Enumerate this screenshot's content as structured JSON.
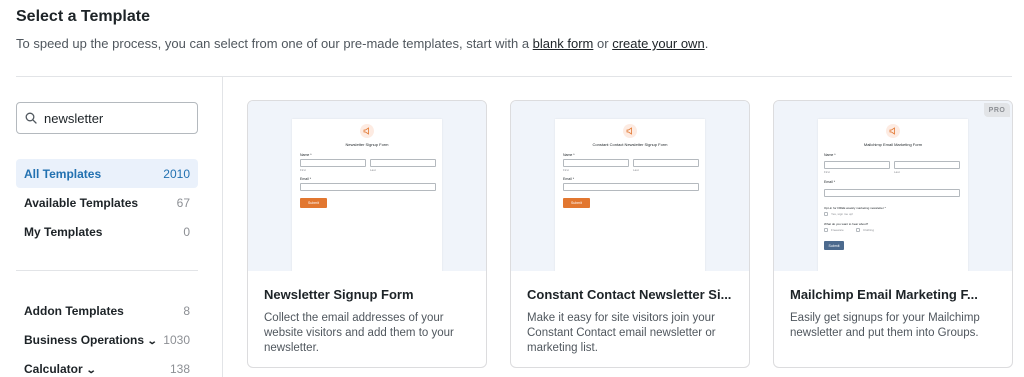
{
  "page": {
    "title": "Select a Template",
    "subtitle_text": "To speed up the process, you can select from one of our pre-made templates, start with a",
    "blank_form_link": "blank form",
    "or_text": "or",
    "create_link": "create your own",
    "period": "."
  },
  "search": {
    "value": "newsletter"
  },
  "categories": [
    {
      "label": "All Templates",
      "count": "2010"
    },
    {
      "label": "Available Templates",
      "count": "67"
    },
    {
      "label": "My Templates",
      "count": "0"
    },
    {
      "label": "Addon Templates",
      "count": "8"
    },
    {
      "label": "Business Operations",
      "count": "1030"
    },
    {
      "label": "Calculator",
      "count": "138"
    }
  ],
  "cards": [
    {
      "title": "Newsletter Signup Form",
      "description": "Collect the email addresses of your website visitors and add them to your newsletter.",
      "preview": {
        "form_title": "Newsletter Signup Form",
        "name_label": "Name *",
        "first_label": "First",
        "last_label": "Last",
        "email_label": "Email *",
        "submit_label": "Submit"
      }
    },
    {
      "title": "Constant Contact Newsletter Si...",
      "description": "Make it easy for site visitors join your Constant Contact email newsletter or marketing list.",
      "preview": {
        "form_title": "Constant Contact Newsletter Signup Form",
        "name_label": "Name *",
        "first_label": "First",
        "last_label": "Last",
        "email_label": "Email *",
        "submit_label": "Submit"
      }
    },
    {
      "title": "Mailchimp Email Marketing F...",
      "description": "Easily get signups for your Mailchimp newsletter and put them into Groups.",
      "badge": "PRO",
      "preview": {
        "form_title": "Mailchimp Email Marketing Form",
        "name_label": "Name *",
        "first_label": "First",
        "last_label": "Last",
        "email_label": "Email *",
        "signup_label": "Opt-in for FREE weekly marketing newsletter *",
        "signup_option": "Yes, sign me up!",
        "interest_label": "What do you want to hear about?",
        "option_a": "Freeware",
        "option_b": "Clothing",
        "submit_label": "Submit"
      }
    }
  ],
  "colors": {
    "accent": "#2271b1",
    "active_bg": "#eaf1fb",
    "button_orange": "#e27730",
    "button_blue": "#4c6a8e"
  }
}
